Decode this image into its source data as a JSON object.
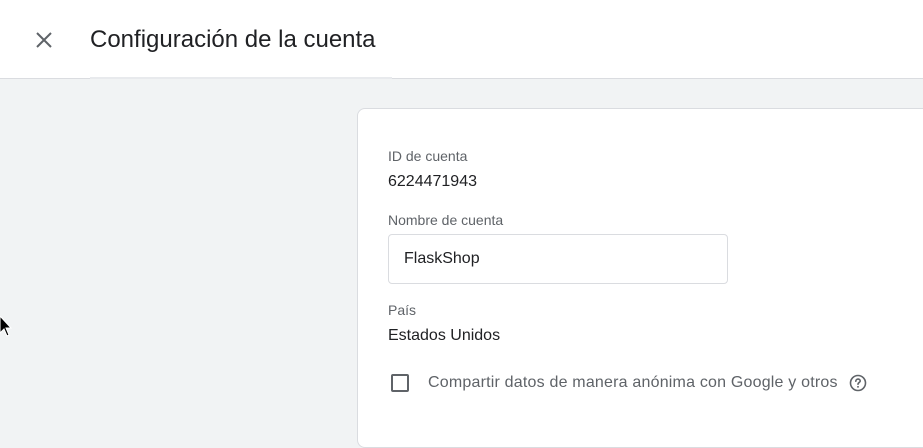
{
  "header": {
    "close_icon": "close-icon",
    "title": "Configuración de la cuenta"
  },
  "account": {
    "id_label": "ID de cuenta",
    "id_value": "6224471943",
    "name_label": "Nombre de cuenta",
    "name_value": "FlaskShop",
    "country_label": "País",
    "country_value": "Estados Unidos",
    "share_label": "Compartir datos de manera anónima con Google y otros",
    "share_checked": false,
    "help_icon": "help-circle-icon"
  },
  "colors": {
    "background": "#f1f3f4",
    "card": "#ffffff",
    "border": "#dadce0",
    "text_primary": "#202124",
    "text_secondary": "#5f6368"
  }
}
